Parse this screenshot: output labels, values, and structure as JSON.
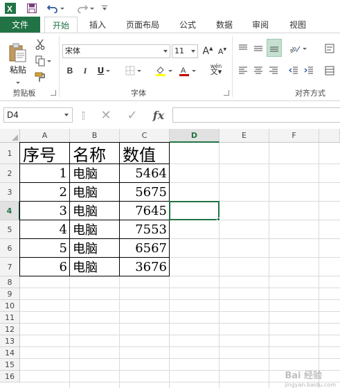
{
  "qat": {
    "excel_icon": "excel-logo-icon",
    "save_icon": "save-icon",
    "undo_icon": "undo-icon",
    "redo_icon": "redo-icon",
    "customize_icon": "customize-qat-icon"
  },
  "tabs": [
    "文件",
    "开始",
    "插入",
    "页面布局",
    "公式",
    "数据",
    "审阅",
    "视图"
  ],
  "ribbon": {
    "clipboard": {
      "paste_label": "粘贴",
      "group_label": "剪贴板"
    },
    "font": {
      "font_name": "宋体",
      "font_size": "11",
      "increase_font": "A",
      "decrease_font": "A",
      "bold": "B",
      "italic": "I",
      "underline": "U",
      "phonetic": "wén",
      "group_label": "字体"
    },
    "alignment": {
      "group_label": "对齐方式"
    }
  },
  "formula_bar": {
    "name_box": "D4",
    "cancel": "✕",
    "enter": "✓",
    "fx": "fx",
    "content": ""
  },
  "columns": [
    "A",
    "B",
    "C",
    "D",
    "E",
    "F"
  ],
  "rows": [
    "1",
    "2",
    "3",
    "4",
    "5",
    "6",
    "7",
    "8",
    "9",
    "10",
    "11",
    "12",
    "13",
    "14",
    "15",
    "16"
  ],
  "table": {
    "headers": [
      "序号",
      "名称",
      "数值"
    ],
    "rows": [
      [
        "1",
        "电脑",
        "5464"
      ],
      [
        "2",
        "电脑",
        "5675"
      ],
      [
        "3",
        "电脑",
        "7645"
      ],
      [
        "4",
        "电脑",
        "7553"
      ],
      [
        "5",
        "电脑",
        "6567"
      ],
      [
        "6",
        "电脑",
        "3676"
      ]
    ]
  },
  "selection": {
    "column": "D",
    "row": "4"
  },
  "watermark": {
    "text": "Bai 经验",
    "sub": "jingyan.baidu.com"
  },
  "colors": {
    "accent": "#217346",
    "font_color": "#c00000",
    "fill_color": "#ffff00"
  }
}
